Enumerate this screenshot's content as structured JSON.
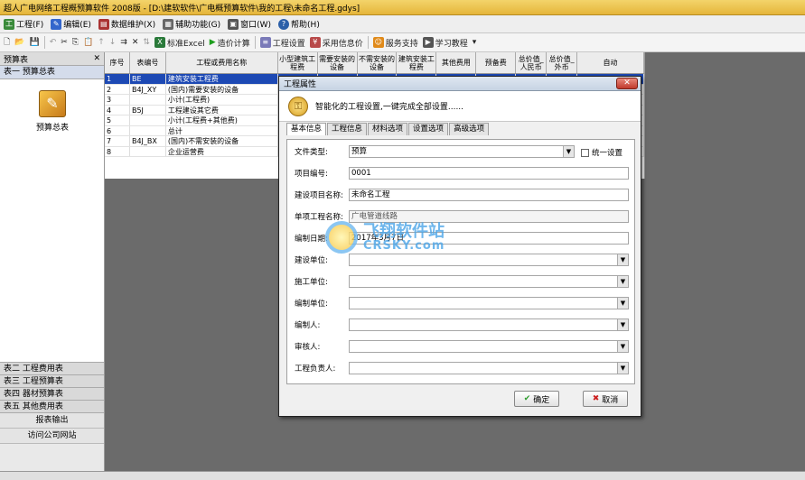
{
  "window": {
    "title": "超人广电网络工程概预算软件 2008版 - [D:\\建软软件\\广电概预算软件\\我的工程\\未命名工程.gdys]"
  },
  "menu": [
    {
      "label": "工程(F)",
      "icon": "project-icon"
    },
    {
      "label": "编辑(E)",
      "icon": "edit-icon"
    },
    {
      "label": "数据维护(X)",
      "icon": "data-maintenance-icon"
    },
    {
      "label": "辅助功能(G)",
      "icon": "assist-icon"
    },
    {
      "label": "窗口(W)",
      "icon": "window-icon"
    },
    {
      "label": "帮助(H)",
      "icon": "help-icon"
    }
  ],
  "toolbar": {
    "standard_excel": "标准Excel",
    "calc": "造价计算",
    "project_settings": "工程设置",
    "use_info_price": "采用信息价",
    "service_support": "服务支持",
    "learning_tutorial": "学习教程"
  },
  "left_panel": {
    "header": "预算表",
    "close": "✕",
    "tab1": "表一 预算总表",
    "item_label": "预算总表",
    "tabs": [
      "表二 工程费用表",
      "表三 工程预算表",
      "表四 器材预算表",
      "表五 其他费用表"
    ],
    "buttons": [
      "报表输出",
      "访问公司网站"
    ]
  },
  "grid": {
    "columns": [
      "序号",
      "表编号",
      "工程或费用名称",
      "小型建筑工程费",
      "需要安装的设备",
      "不需安装的设备",
      "建筑安装工程费",
      "其他费用",
      "预备费",
      "总价值_人民币",
      "总价值_外币",
      "自动"
    ],
    "rows": [
      {
        "no": "1",
        "code": "BE",
        "name": "建筑安装工程费",
        "selected": true
      },
      {
        "no": "2",
        "code": "B4J_XY",
        "name": "(国内)需要安装的设备",
        "selected": false
      },
      {
        "no": "3",
        "code": "",
        "name": "小计(工程费)",
        "selected": false
      },
      {
        "no": "4",
        "code": "B5J",
        "name": "工程建设其它费",
        "selected": false
      },
      {
        "no": "5",
        "code": "",
        "name": "小计(工程费+其他费)",
        "selected": false
      },
      {
        "no": "6",
        "code": "",
        "name": "总计",
        "selected": false
      },
      {
        "no": "7",
        "code": "B4J_BX",
        "name": "(国内)不需安装的设备",
        "selected": false
      },
      {
        "no": "8",
        "code": "",
        "name": "企业运营费",
        "selected": false
      }
    ]
  },
  "dialog": {
    "title": "工程属性",
    "close": "✕",
    "banner": "智能化的工程设置,一键完成全部设置......",
    "tabs": [
      "基本信息",
      "工程信息",
      "材料选项",
      "设置选项",
      "高级选项"
    ],
    "active_tab": "基本信息",
    "fields": {
      "file_type": {
        "label": "文件类型:",
        "value": "预算"
      },
      "unified_setting": "统一设置",
      "project_no": {
        "label": "项目编号:",
        "value": "0001"
      },
      "project_name": {
        "label": "建设项目名称:",
        "value": "未命名工程"
      },
      "unit_project_name": {
        "label": "单项工程名称:",
        "value": "广电管道线路"
      },
      "date": {
        "label": "编制日期:",
        "value": "2017年3月7日"
      },
      "build_unit": {
        "label": "建设单位:",
        "value": ""
      },
      "construct_unit": {
        "label": "施工单位:",
        "value": ""
      },
      "compile_unit": {
        "label": "编制单位:",
        "value": ""
      },
      "compiler": {
        "label": "编制人:",
        "value": ""
      },
      "reviewer": {
        "label": "审核人:",
        "value": ""
      },
      "project_lead": {
        "label": "工程负责人:",
        "value": ""
      }
    },
    "ok": "确定",
    "cancel": "取消"
  },
  "watermark": {
    "line1": "飞翔软件站",
    "line2": "CRSKY.com"
  },
  "colors": {
    "selection": "#1d49b4",
    "title_bar": "#e5b53a",
    "ok_check": "#2e9e2e",
    "cancel_x": "#cc1f1f"
  }
}
